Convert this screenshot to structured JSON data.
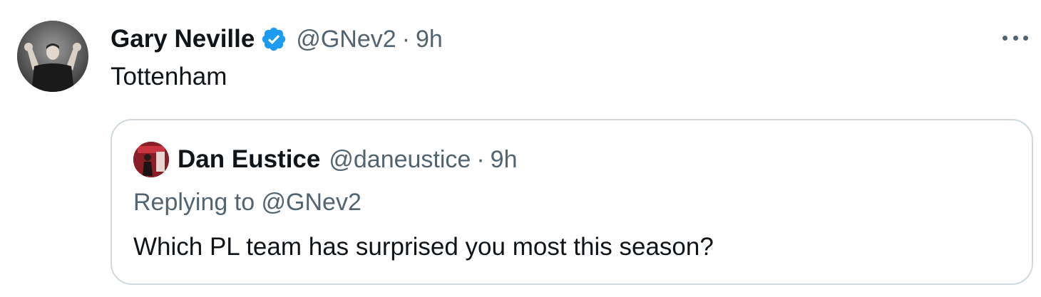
{
  "tweet": {
    "author": {
      "display_name": "Gary Neville",
      "handle": "@GNev2",
      "verified": true,
      "avatar": "user-avatar"
    },
    "separator": "·",
    "time": "9h",
    "text": "Tottenham",
    "more_icon": "more-horizontal-icon"
  },
  "quoted_tweet": {
    "author": {
      "display_name": "Dan Eustice",
      "handle": "@daneustice",
      "avatar": "user-avatar"
    },
    "separator": "·",
    "time": "9h",
    "replying_to": "Replying to @GNev2",
    "text": "Which PL team has surprised you most this season?"
  },
  "colors": {
    "text_primary": "#0f1419",
    "text_secondary": "#536471",
    "verified_blue": "#1d9bf0",
    "border": "#cfd9de"
  }
}
